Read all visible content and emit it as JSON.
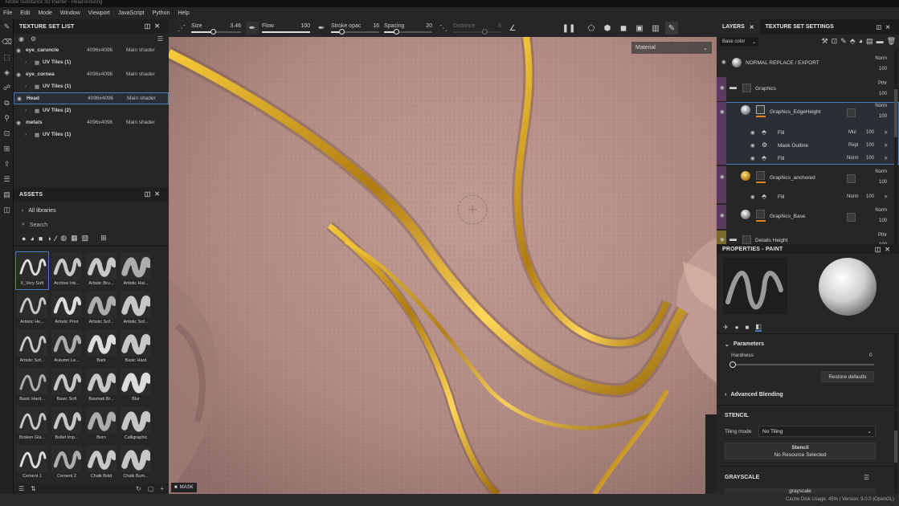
{
  "window_title": "Adobe Substance 3D Painter - HeadTexturing",
  "menu": [
    "File",
    "Edit",
    "Mode",
    "Window",
    "Viewport",
    "JavaScript",
    "Python",
    "Help"
  ],
  "toolbar": {
    "size_label": "Size",
    "size_value": "3.46",
    "flow_label": "Flow",
    "flow_value": "100",
    "stroke_label": "Stroke opac",
    "stroke_value": "16",
    "spacing_label": "Spacing",
    "spacing_value": "20",
    "distance_label": "Distance",
    "distance_value": "8"
  },
  "texture_set_list": {
    "title": "TEXTURE SET LIST",
    "sets": [
      {
        "name": "eye_caruncle",
        "res": "4096x4096",
        "shader": "Main shader",
        "uv": "UV Tiles (1)"
      },
      {
        "name": "eye_cornea",
        "res": "4096x4096",
        "shader": "Main shader",
        "uv": "UV Tiles (1)"
      },
      {
        "name": "Head",
        "res": "4096x4096",
        "shader": "Main shader",
        "uv": "UV Tiles (2)"
      },
      {
        "name": "metals",
        "res": "4096x4096",
        "shader": "Main shader",
        "uv": "UV Tiles (1)"
      }
    ]
  },
  "assets": {
    "title": "ASSETS",
    "library": "All libraries",
    "search_placeholder": "Search",
    "items": [
      "0_Very Soft",
      "Archive Ink...",
      "Artistic Bru...",
      "Artistic Hai...",
      "Artistic He...",
      "Artistic Print",
      "Artistic Sof...",
      "Artistic Sof...",
      "Artistic Sof...",
      "Autumn Le...",
      "Bark",
      "Basic Hard",
      "Basic Hard...",
      "Basic Soft",
      "Basmati Br...",
      "Blur",
      "Broken Gla...",
      "Bullet Imp...",
      "Burn",
      "Calligraphic",
      "Cement 1",
      "Cement 2",
      "Chalk Bold",
      "Chalk Bum..."
    ]
  },
  "viewport": {
    "material_mode": "Material",
    "mask_label": "MASK"
  },
  "layers": {
    "tab_layers": "LAYERS",
    "tab_tss": "TEXTURE SET SETTINGS",
    "channel": "Base color",
    "rows": [
      {
        "name": "NORMAL REPLACE / EXPORT",
        "blend": "Norm",
        "opacity": "100"
      },
      {
        "name": "Graphics",
        "blend": "Pthr",
        "opacity": "100"
      },
      {
        "name": "Graphics_EdgeHeight",
        "blend": "Norm",
        "opacity": "100"
      },
      {
        "name": "Fill",
        "blend": "Mul",
        "opacity": "100"
      },
      {
        "name": "Mask Outline",
        "blend": "Repl",
        "opacity": "100"
      },
      {
        "name": "Fill",
        "blend": "Norm",
        "opacity": "100"
      },
      {
        "name": "Graphics_anchored",
        "blend": "Norm",
        "opacity": "100"
      },
      {
        "name": "Fill",
        "blend": "Norm",
        "opacity": "100"
      },
      {
        "name": "Graphics_Base",
        "blend": "Norm",
        "opacity": "100"
      },
      {
        "name": "Details Height",
        "blend": "Pthr",
        "opacity": "100"
      }
    ]
  },
  "properties": {
    "title": "PROPERTIES - PAINT",
    "parameters": "Parameters",
    "hardness_label": "Hardness",
    "hardness_value": "0",
    "restore": "Restore defaults",
    "advanced": "Advanced Blending",
    "stencil_title": "STENCIL",
    "tiling_label": "Tiling mode",
    "tiling_value": "No Tiling",
    "stencil_btn": "Stencil",
    "stencil_sub": "No Resource Selected",
    "grayscale_title": "GRAYSCALE",
    "grayscale_value": "grayscale"
  },
  "status": "Cache Disk Usage: 45% | Version: 9.0.0 (OpenGL)",
  "colors": {
    "accent": "#4a7dbf",
    "gold": "#d9a520",
    "skin": "#b08d86",
    "orange": "#e8801e"
  }
}
